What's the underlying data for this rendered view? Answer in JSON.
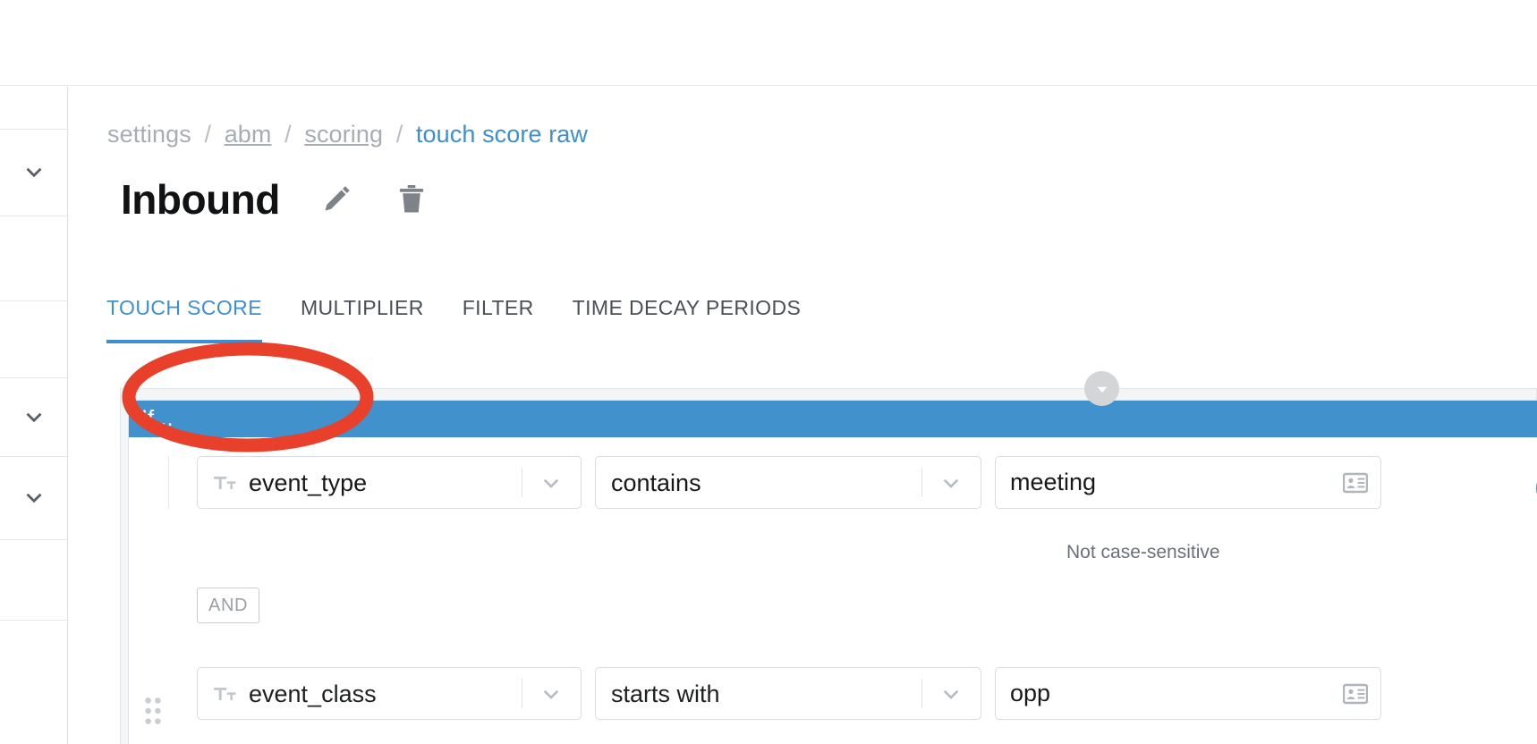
{
  "colors": {
    "accent_blue": "#3d90cf",
    "header_blue": "#4191cd",
    "annotation_red": "#e8402a",
    "muted_gray": "#a7adb4",
    "panel_bg": "#f4f5f7"
  },
  "breadcrumb": {
    "items": [
      {
        "label": "settings",
        "style": "plain"
      },
      {
        "label": "abm",
        "style": "link"
      },
      {
        "label": "scoring",
        "style": "link"
      },
      {
        "label": "touch score raw",
        "style": "current"
      }
    ],
    "separator": "/"
  },
  "header": {
    "title": "Inbound",
    "edit_icon": "pencil-icon",
    "delete_icon": "trash-icon"
  },
  "tabs": [
    {
      "label": "TOUCH SCORE",
      "active": true
    },
    {
      "label": "MULTIPLIER",
      "active": false
    },
    {
      "label": "FILTER",
      "active": false
    },
    {
      "label": "TIME DECAY PERIODS",
      "active": false
    }
  ],
  "annotation": {
    "shape": "ellipse",
    "target": "TOUCH SCORE",
    "color": "#e8402a"
  },
  "builder": {
    "collapse_icon": "caret-down-icon",
    "if_label": "If...",
    "conditions": [
      {
        "attribute": {
          "value": "event_type",
          "type_icon": "text-type-icon"
        },
        "operator": {
          "value": "contains"
        },
        "value": {
          "value": "meeting",
          "placeholder": "",
          "trailing_icon": "contact-card-icon"
        },
        "helper": "Not case-sensitive"
      },
      {
        "attribute": {
          "value": "event_class",
          "type_icon": "text-type-icon"
        },
        "operator": {
          "value": "starts with"
        },
        "value": {
          "value": "opp",
          "placeholder": "",
          "trailing_icon": "contact-card-icon"
        },
        "helper": ""
      }
    ],
    "join_operator": "AND"
  },
  "sidebar": {
    "rows": [
      {
        "chevron": false
      },
      {
        "chevron": true
      },
      {
        "chevron": false
      },
      {
        "chevron": false
      },
      {
        "chevron": true
      },
      {
        "chevron": true
      },
      {
        "chevron": false
      },
      {
        "chevron": false
      }
    ],
    "chevron_icon": "chevron-down-icon"
  }
}
